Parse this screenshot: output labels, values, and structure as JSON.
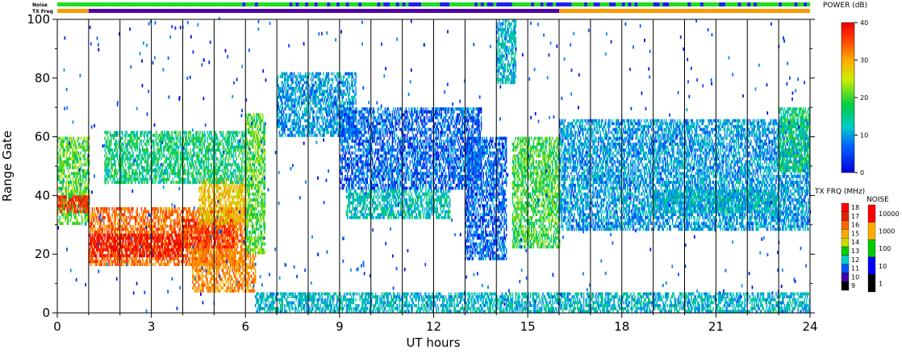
{
  "chart_data": {
    "type": "heatmap",
    "xlabel": "UT hours",
    "ylabel": "Range Gate",
    "xlim": [
      0,
      24
    ],
    "ylim": [
      0,
      100
    ],
    "x_ticks": [
      "0",
      "3",
      "6",
      "9",
      "12",
      "15",
      "18",
      "21",
      "24"
    ],
    "y_ticks": [
      "0",
      "20",
      "40",
      "60",
      "80",
      "100"
    ],
    "top_bars": {
      "noise_label": "Noise",
      "txfreq_label": "TX Freq",
      "txfreq_segments": [
        {
          "start": 0,
          "end": 1,
          "color": "#ff9900"
        },
        {
          "start": 1,
          "end": 16,
          "color": "#5500aa"
        },
        {
          "start": 16,
          "end": 24,
          "color": "#ff9900"
        }
      ]
    },
    "power_scale": {
      "title": "POWER (dB)",
      "ticks": [
        "40",
        "30",
        "20",
        "10",
        "0"
      ],
      "range": [
        0,
        40
      ]
    },
    "txfreq_scale": {
      "title": "TX FRQ (MHz)",
      "levels": [
        "18",
        "17",
        "16",
        "15",
        "14",
        "13",
        "12",
        "11",
        "10",
        "9"
      ],
      "colors": [
        "#ff0000",
        "#dd2200",
        "#ff6600",
        "#ffaa00",
        "#ccdd00",
        "#00cc00",
        "#00cccc",
        "#0055ff",
        "#4400aa",
        "#000000"
      ]
    },
    "noise_scale": {
      "title": "NOISE",
      "levels": [
        "10000",
        "1000",
        "100",
        "10",
        "1"
      ],
      "colors": [
        "#ff0000",
        "#ffaa00",
        "#00cc00",
        "#0000ff",
        "#000000"
      ]
    },
    "echo_regions": [
      {
        "t0": 0.0,
        "t1": 1.0,
        "g0": 30,
        "g1": 60,
        "power": 18
      },
      {
        "t0": 0.0,
        "t1": 1.0,
        "g0": 34,
        "g1": 40,
        "power": 36
      },
      {
        "t0": 1.0,
        "t1": 6.0,
        "g0": 16,
        "g1": 36,
        "power": 32
      },
      {
        "t0": 1.0,
        "t1": 4.0,
        "g0": 19,
        "g1": 27,
        "power": 39
      },
      {
        "t0": 4.0,
        "t1": 5.6,
        "g0": 22,
        "g1": 32,
        "power": 36
      },
      {
        "t0": 4.5,
        "t1": 6.0,
        "g0": 30,
        "g1": 46,
        "power": 26
      },
      {
        "t0": 1.5,
        "t1": 6.0,
        "g0": 44,
        "g1": 62,
        "power": 14
      },
      {
        "t0": 4.3,
        "t1": 6.3,
        "g0": 7,
        "g1": 22,
        "power": 30
      },
      {
        "t0": 6.0,
        "t1": 6.6,
        "g0": 20,
        "g1": 68,
        "power": 18
      },
      {
        "t0": 7.0,
        "t1": 9.5,
        "g0": 60,
        "g1": 82,
        "power": 8
      },
      {
        "t0": 9.2,
        "t1": 12.5,
        "g0": 32,
        "g1": 42,
        "power": 11
      },
      {
        "t0": 9.0,
        "t1": 13.5,
        "g0": 42,
        "g1": 70,
        "power": 5
      },
      {
        "t0": 13.0,
        "t1": 14.3,
        "g0": 18,
        "g1": 60,
        "power": 5
      },
      {
        "t0": 14.0,
        "t1": 14.6,
        "g0": 78,
        "g1": 100,
        "power": 10
      },
      {
        "t0": 14.5,
        "t1": 16.0,
        "g0": 22,
        "g1": 60,
        "power": 17
      },
      {
        "t0": 16.0,
        "t1": 24.0,
        "g0": 28,
        "g1": 66,
        "power": 8
      },
      {
        "t0": 19.0,
        "t1": 23.0,
        "g0": 34,
        "g1": 42,
        "power": 10
      },
      {
        "t0": 23.0,
        "t1": 24.0,
        "g0": 48,
        "g1": 70,
        "power": 14
      },
      {
        "t0": 6.3,
        "t1": 24.0,
        "g0": 0,
        "g1": 7,
        "power": 10
      }
    ]
  }
}
